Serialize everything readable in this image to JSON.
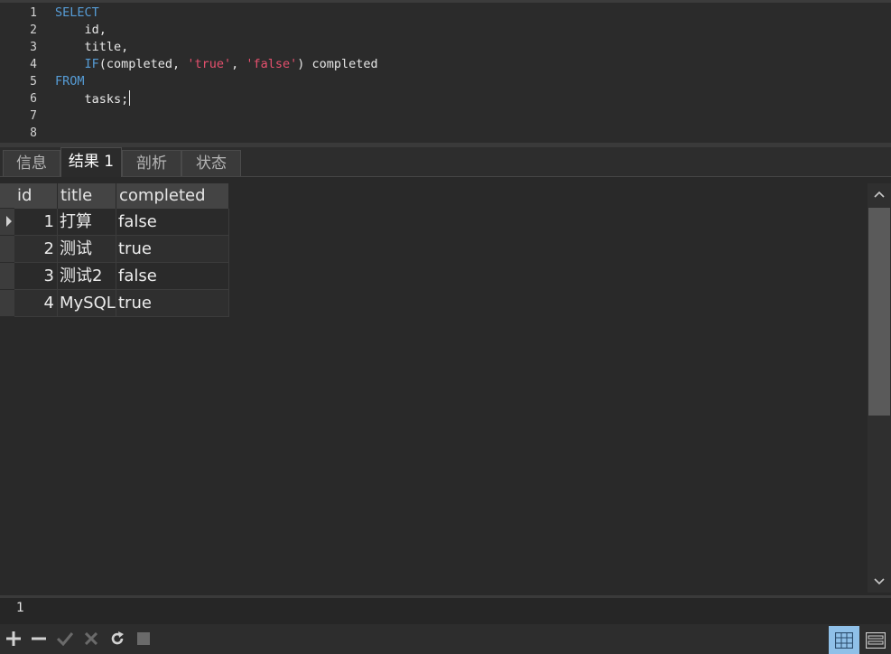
{
  "editor": {
    "line_numbers": [
      "1",
      "2",
      "3",
      "4",
      "5",
      "6",
      "7",
      "8"
    ],
    "lines": [
      [
        {
          "t": "SELECT",
          "c": "kw"
        }
      ],
      [
        {
          "t": "    id,",
          "c": ""
        }
      ],
      [
        {
          "t": "    title,",
          "c": ""
        }
      ],
      [
        {
          "t": "    ",
          "c": ""
        },
        {
          "t": "IF",
          "c": "kw"
        },
        {
          "t": "(completed, ",
          "c": ""
        },
        {
          "t": "'true'",
          "c": "str"
        },
        {
          "t": ", ",
          "c": ""
        },
        {
          "t": "'false'",
          "c": "str"
        },
        {
          "t": ") completed",
          "c": ""
        }
      ],
      [
        {
          "t": "FROM",
          "c": "kw"
        }
      ],
      [
        {
          "t": "    tasks;",
          "c": ""
        }
      ],
      [],
      []
    ]
  },
  "tabs": [
    {
      "label": "信息",
      "active": false
    },
    {
      "label": "结果 1",
      "active": true
    },
    {
      "label": "剖析",
      "active": false
    },
    {
      "label": "状态",
      "active": false
    }
  ],
  "grid": {
    "columns": [
      "id",
      "title",
      "completed"
    ],
    "rows": [
      [
        "1",
        "打算",
        "false"
      ],
      [
        "2",
        "测试",
        "true"
      ],
      [
        "3",
        "测试2",
        "false"
      ],
      [
        "4",
        "MySQL",
        "true"
      ]
    ]
  },
  "status": {
    "text": "1"
  },
  "toolbar": {
    "icons": [
      "plus-icon",
      "minus-icon",
      "check-icon",
      "close-icon",
      "refresh-icon",
      "stop-icon"
    ],
    "views": [
      "grid-view-icon",
      "form-view-icon"
    ]
  },
  "colors": {
    "keyword": "#569cd6",
    "string": "#e6506e",
    "accent": "#8fc0e8"
  }
}
